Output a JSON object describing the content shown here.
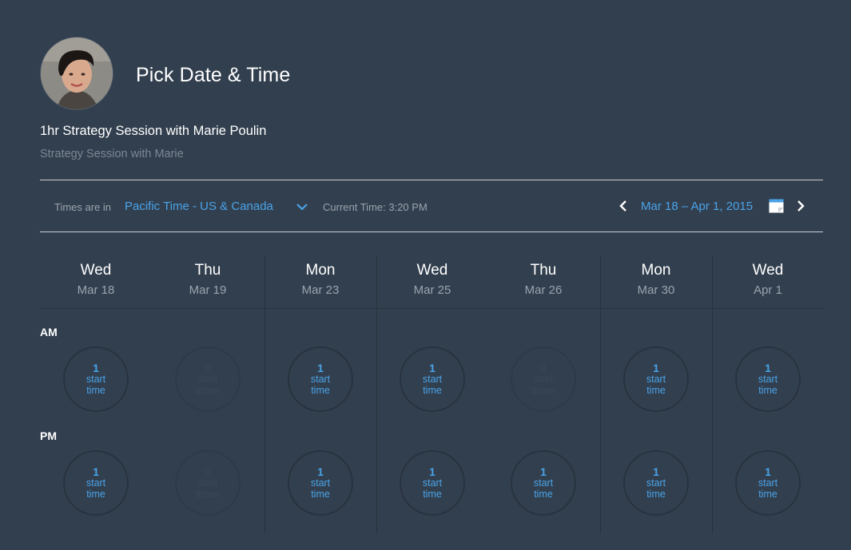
{
  "header": {
    "title": "Pick Date & Time",
    "event_title": "1hr Strategy Session with Marie Poulin",
    "event_subtitle": "Strategy Session with Marie"
  },
  "toolbar": {
    "times_label": "Times are in",
    "timezone": "Pacific Time - US & Canada",
    "current_time": "Current Time: 3:20 PM",
    "date_range": "Mar 18 – Apr 1, 2015",
    "icons": [
      "chevron-down-icon",
      "chevron-left-icon",
      "calendar-icon",
      "chevron-right-icon"
    ]
  },
  "periods": {
    "am": "AM",
    "pm": "PM"
  },
  "days": [
    {
      "name": "Wed",
      "date": "Mar 18",
      "am": {
        "count": "1",
        "l1": "start",
        "l2": "time"
      },
      "pm": {
        "count": "1",
        "l1": "start",
        "l2": "time"
      }
    },
    {
      "name": "Thu",
      "date": "Mar 19",
      "am": {
        "count": "0",
        "l1": "start",
        "l2": "times"
      },
      "pm": {
        "count": "0",
        "l1": "start",
        "l2": "times"
      }
    },
    {
      "name": "Mon",
      "date": "Mar 23",
      "am": {
        "count": "1",
        "l1": "start",
        "l2": "time"
      },
      "pm": {
        "count": "1",
        "l1": "start",
        "l2": "time"
      }
    },
    {
      "name": "Wed",
      "date": "Mar 25",
      "am": {
        "count": "1",
        "l1": "start",
        "l2": "time"
      },
      "pm": {
        "count": "1",
        "l1": "start",
        "l2": "time"
      }
    },
    {
      "name": "Thu",
      "date": "Mar 26",
      "am": {
        "count": "0",
        "l1": "start",
        "l2": "times"
      },
      "pm": {
        "count": "1",
        "l1": "start",
        "l2": "time"
      }
    },
    {
      "name": "Mon",
      "date": "Mar 30",
      "am": {
        "count": "1",
        "l1": "start",
        "l2": "time"
      },
      "pm": {
        "count": "1",
        "l1": "start",
        "l2": "time"
      }
    },
    {
      "name": "Wed",
      "date": "Apr 1",
      "am": {
        "count": "1",
        "l1": "start",
        "l2": "time"
      },
      "pm": {
        "count": "1",
        "l1": "start",
        "l2": "time"
      }
    }
  ],
  "colors": {
    "background": "#323f4e",
    "accent": "#4aa3e8",
    "muted_text": "#9ba4ae",
    "disabled_text": "#3a4757"
  }
}
